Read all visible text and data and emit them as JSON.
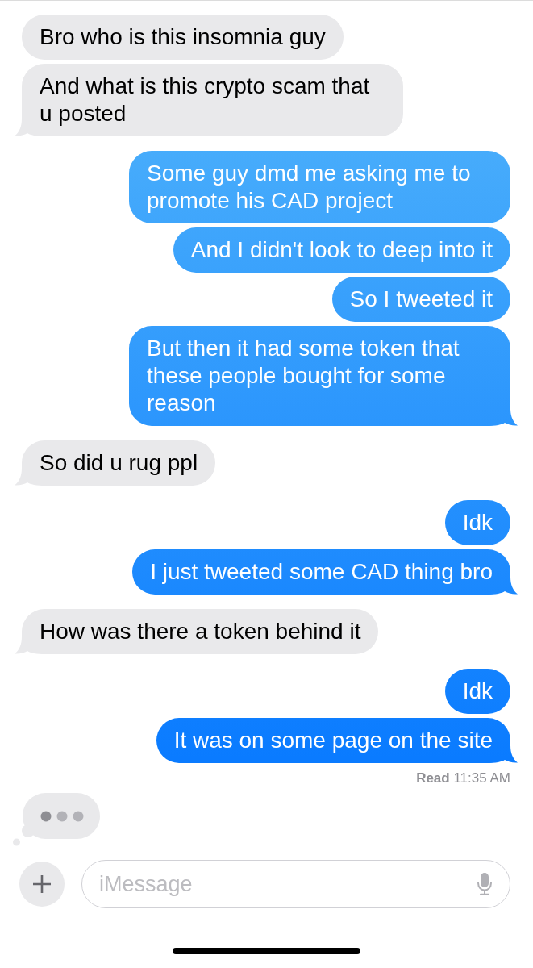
{
  "messages": [
    {
      "kind": "received",
      "text": "Bro who is this insomnia guy"
    },
    {
      "kind": "received",
      "text": "And what is this crypto scam that u posted"
    },
    {
      "kind": "sent",
      "text": "Some guy dmd me asking me to promote his CAD project"
    },
    {
      "kind": "sent",
      "text": "And I didn't look to deep into it"
    },
    {
      "kind": "sent",
      "text": "So I tweeted it"
    },
    {
      "kind": "sent",
      "text": "But then it had some token that these people bought for some reason"
    },
    {
      "kind": "received",
      "text": "So did u rug ppl"
    },
    {
      "kind": "sent",
      "text": "Idk"
    },
    {
      "kind": "sent",
      "text": "I just tweeted some CAD thing bro"
    },
    {
      "kind": "received",
      "text": "How was there a token behind it"
    },
    {
      "kind": "sent",
      "text": "Idk"
    },
    {
      "kind": "sent",
      "text": "It was on some page on the site"
    }
  ],
  "receipt": "**Read** 11:35 AM",
  "typing": true,
  "composer": {
    "placeholder": "iMessage"
  }
}
